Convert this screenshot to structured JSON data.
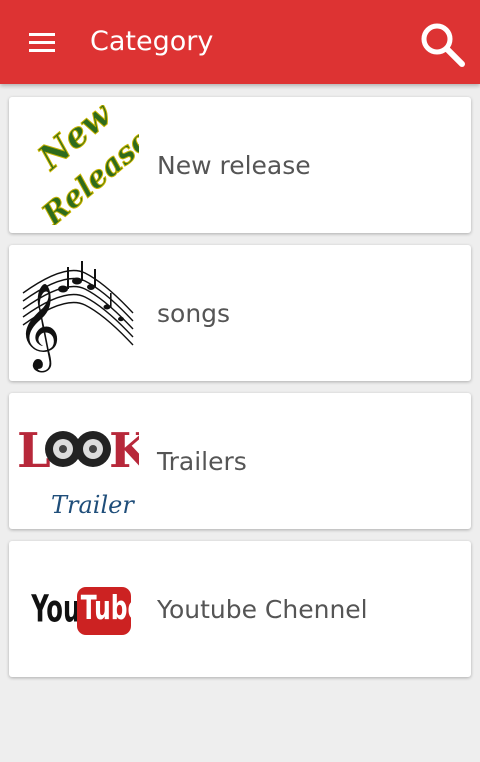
{
  "appbar": {
    "title": "Category",
    "menu_icon": "hamburger-menu-icon",
    "search_icon": "search-icon",
    "color": "#dd3333"
  },
  "categories": [
    {
      "label": "New release",
      "thumb_icon": "new-releases-logo",
      "thumb_text_1": "New",
      "thumb_text_2": "Releases"
    },
    {
      "label": "songs",
      "thumb_icon": "music-notes-icon"
    },
    {
      "label": "Trailers",
      "thumb_icon": "look-trailer-logo",
      "thumb_text_1": "L",
      "thumb_text_2": "K",
      "thumb_text_3": "Trailer"
    },
    {
      "label": "Youtube Chennel",
      "thumb_icon": "youtube-logo",
      "thumb_text_1": "You",
      "thumb_text_2": "Tube"
    }
  ]
}
